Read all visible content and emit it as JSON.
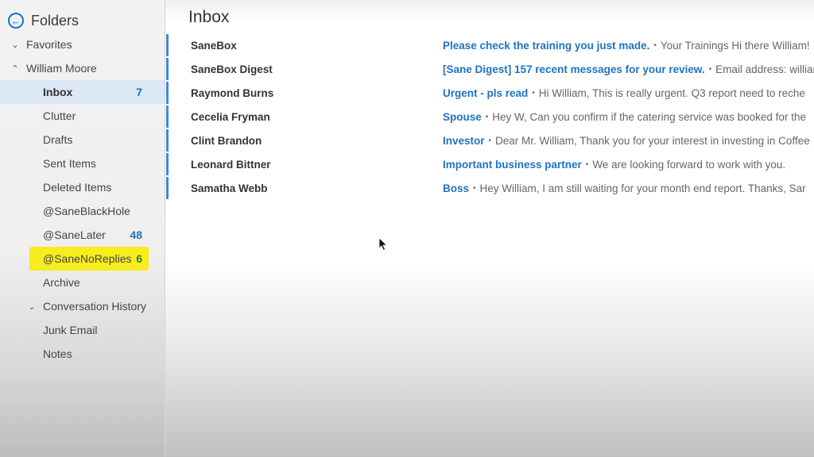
{
  "sidebar": {
    "title": "Folders",
    "back_icon": "back-arrow-circle-icon",
    "groups": [
      {
        "label": "Favorites",
        "chevron": "chevron-down-icon"
      },
      {
        "label": "William Moore",
        "chevron": "chevron-up-icon"
      }
    ],
    "folders": [
      {
        "label": "Inbox",
        "count": "7",
        "selected": true
      },
      {
        "label": "Clutter",
        "count": ""
      },
      {
        "label": "Drafts",
        "count": ""
      },
      {
        "label": "Sent Items",
        "count": ""
      },
      {
        "label": "Deleted Items",
        "count": ""
      },
      {
        "label": "@SaneBlackHole",
        "count": ""
      },
      {
        "label": "@SaneLater",
        "count": "48"
      },
      {
        "label": "@SaneNoReplies",
        "count": "6",
        "highlighted": true
      },
      {
        "label": "Archive",
        "count": ""
      },
      {
        "label": "Conversation History",
        "count": "",
        "chevron": "chevron-down-icon"
      },
      {
        "label": "Junk Email",
        "count": ""
      },
      {
        "label": "Notes",
        "count": ""
      }
    ]
  },
  "main": {
    "title": "Inbox",
    "messages": [
      {
        "sender": "SaneBox",
        "subject": "Please check the training you just made.",
        "preview": "Your Trainings  Hi there William!",
        "unread": true
      },
      {
        "sender": "SaneBox Digest",
        "subject": "[Sane Digest] 157 recent messages for your review.",
        "preview": "Email address: william",
        "unread": true
      },
      {
        "sender": "Raymond Burns",
        "subject": "Urgent - pls read",
        "preview": "Hi William,  This is really urgent. Q3 report need to reche",
        "unread": true
      },
      {
        "sender": "Cecelia Fryman",
        "subject": "Spouse",
        "preview": "Hey W,  Can you confirm if the catering service was booked for the",
        "unread": true
      },
      {
        "sender": "Clint Brandon",
        "subject": "Investor",
        "preview": "Dear Mr. William,  Thank you for your interest in investing in Coffee",
        "unread": true
      },
      {
        "sender": "Leonard Bittner",
        "subject": "Important business partner",
        "preview": "We are looking forward to work with you.",
        "unread": true
      },
      {
        "sender": "Samatha Webb",
        "subject": "Boss",
        "preview": "Hey William,  I am still waiting for your month end report.  Thanks, Sar",
        "unread": true
      }
    ],
    "separator": "•"
  },
  "colors": {
    "accent": "#1e73c2",
    "unread_bar": "#3e8ad8",
    "selected_bg": "#dbe8f5",
    "highlight": "#f7ec1c",
    "highlight_count": "#2e7d32"
  }
}
